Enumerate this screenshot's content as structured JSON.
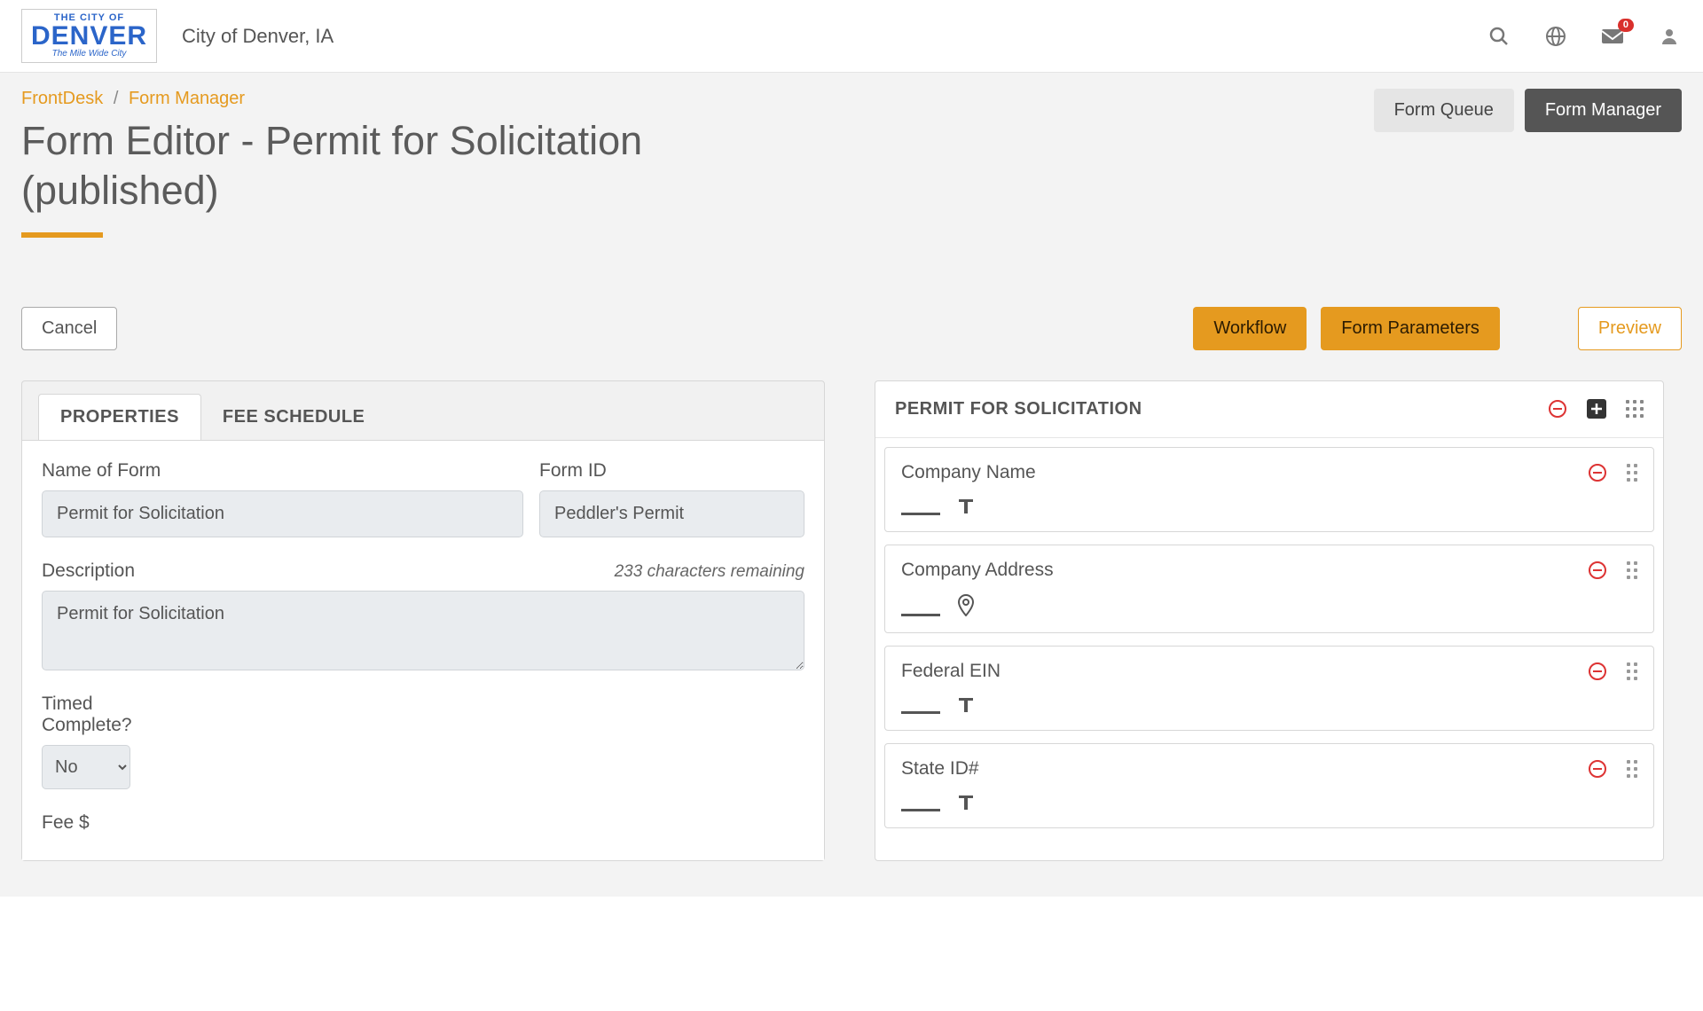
{
  "header": {
    "org_name": "City of Denver, IA",
    "notifications": "0"
  },
  "breadcrumb": {
    "root": "FrontDesk",
    "current": "Form Manager"
  },
  "top_buttons": {
    "queue": "Form Queue",
    "manager": "Form Manager"
  },
  "page_title": "Form Editor - Permit for Solicitation (published)",
  "actions": {
    "cancel": "Cancel",
    "workflow": "Workflow",
    "parameters": "Form Parameters",
    "preview": "Preview"
  },
  "tabs": {
    "properties": "PROPERTIES",
    "fee_schedule": "FEE SCHEDULE"
  },
  "properties": {
    "name_label": "Name of Form",
    "name_value": "Permit for Solicitation",
    "formid_label": "Form ID",
    "formid_value": "Peddler's Permit",
    "description_label": "Description",
    "chars_remaining": "233 characters remaining",
    "description_value": "Permit for Solicitation",
    "timed_label": "Timed Complete?",
    "timed_value": "No",
    "fee_label": "Fee $"
  },
  "builder": {
    "section_title": "PERMIT FOR SOLICITATION",
    "fields": [
      {
        "label": "Company Name",
        "type": "text"
      },
      {
        "label": "Company Address",
        "type": "location"
      },
      {
        "label": "Federal EIN",
        "type": "text"
      },
      {
        "label": "State ID#",
        "type": "text"
      }
    ]
  }
}
